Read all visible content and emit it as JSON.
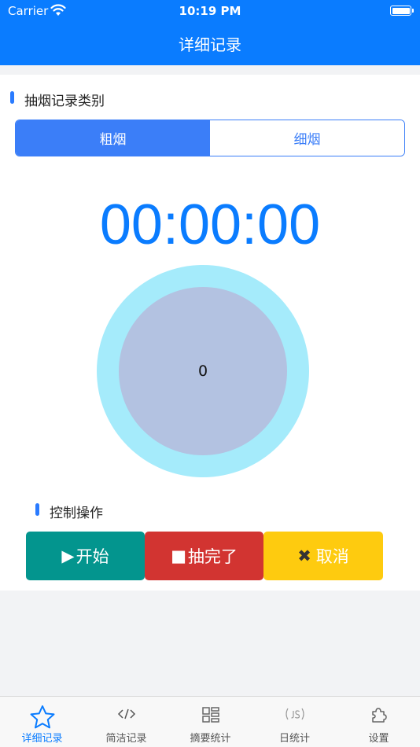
{
  "status_bar": {
    "carrier": "Carrier",
    "time": "10:19 PM"
  },
  "nav": {
    "title": "详细记录"
  },
  "category": {
    "title": "抽烟记录类别",
    "options": [
      {
        "label": "粗烟",
        "selected": true
      },
      {
        "label": "细烟",
        "selected": false
      }
    ]
  },
  "timer": {
    "display": "00:00:00"
  },
  "counter": {
    "value": "0"
  },
  "controls": {
    "title": "控制操作",
    "start_label": "开始",
    "done_label": "抽完了",
    "cancel_label": "取消"
  },
  "tabs": [
    {
      "label": "详细记录",
      "icon": "star-icon",
      "active": true
    },
    {
      "label": "简洁记录",
      "icon": "code-icon",
      "active": false
    },
    {
      "label": "摘要统计",
      "icon": "grid-icon",
      "active": false
    },
    {
      "label": "日统计",
      "icon": "js-icon",
      "active": false
    },
    {
      "label": "设置",
      "icon": "puzzle-icon",
      "active": false
    }
  ],
  "colors": {
    "primary": "#0a7cff",
    "segment": "#3b7ef8",
    "start": "#03958e",
    "done": "#d23431",
    "cancel": "#fecb0f",
    "ring_outer": "#a5ebfb",
    "ring_inner": "#b3c2e1"
  }
}
